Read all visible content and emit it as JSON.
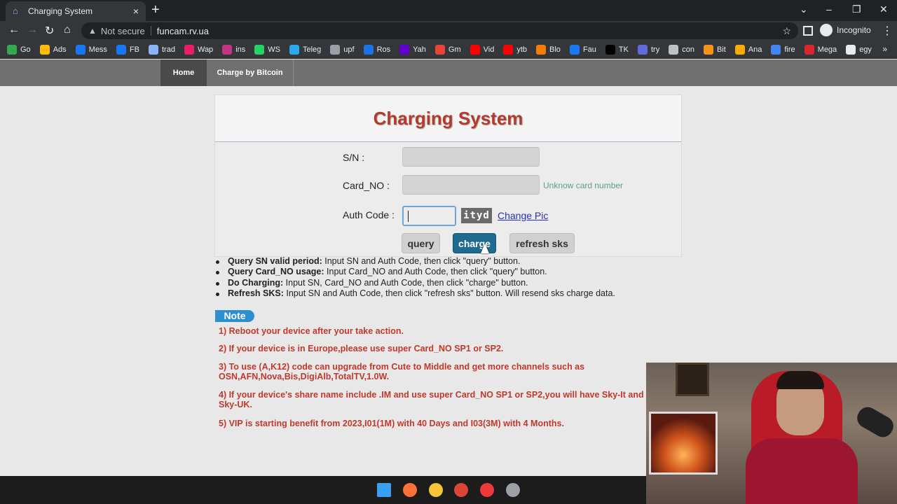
{
  "browser": {
    "tab_title": "Charging System",
    "tab_close": "×",
    "new_tab": "+",
    "security_label": "Not secure",
    "url": "funcam.rv.ua",
    "profile_label": "Incognito",
    "window_controls": [
      "⌄",
      "–",
      "❐",
      "✕"
    ]
  },
  "bookmarks": [
    {
      "label": "Go",
      "color": "#34a853"
    },
    {
      "label": "Ads",
      "color": "#fbbc04"
    },
    {
      "label": "Mess",
      "color": "#1877f2"
    },
    {
      "label": "FB",
      "color": "#1877f2"
    },
    {
      "label": "trad",
      "color": "#8ab4f8"
    },
    {
      "label": "Wap",
      "color": "#e91e63"
    },
    {
      "label": "ins",
      "color": "#c13584"
    },
    {
      "label": "WS",
      "color": "#25d366"
    },
    {
      "label": "Teleg",
      "color": "#29a9eb"
    },
    {
      "label": "upf",
      "color": "#9aa0a6"
    },
    {
      "label": "Ros",
      "color": "#1a73e8"
    },
    {
      "label": "Yah",
      "color": "#6001d2"
    },
    {
      "label": "Gm",
      "color": "#ea4335"
    },
    {
      "label": "Vid",
      "color": "#ff0000"
    },
    {
      "label": "ytb",
      "color": "#ff0000"
    },
    {
      "label": "Blo",
      "color": "#f57d00"
    },
    {
      "label": "Fau",
      "color": "#1877f2"
    },
    {
      "label": "TK",
      "color": "#010101"
    },
    {
      "label": "try",
      "color": "#5f6bd8"
    },
    {
      "label": "con",
      "color": "#bdc1c6"
    },
    {
      "label": "Bit",
      "color": "#f7931a"
    },
    {
      "label": "Ana",
      "color": "#f9ab00"
    },
    {
      "label": "fire",
      "color": "#4285f4"
    },
    {
      "label": "Mega",
      "color": "#d9272e"
    },
    {
      "label": "egy",
      "color": "#e8eaed"
    }
  ],
  "bookmarks_more": "»",
  "site_nav": {
    "home": "Home",
    "bitcoin": "Charge by Bitcoin"
  },
  "form": {
    "title": "Charging System",
    "sn_label": "S/N :",
    "card_label": "Card_NO :",
    "card_hint": "Unknow card number",
    "auth_label": "Auth Code :",
    "captcha_text": "ityd",
    "change_pic": "Change Pic",
    "query_btn": "query",
    "charge_btn": "charge",
    "refresh_btn": "refresh sks"
  },
  "instructions": [
    {
      "bold": "Query SN valid period:",
      "text": " Input SN and Auth Code, then click \"query\" button."
    },
    {
      "bold": "Query Card_NO usage:",
      "text": " Input Card_NO and Auth Code, then click \"query\" button."
    },
    {
      "bold": "Do Charging:",
      "text": " Input SN, Card_NO and Auth Code, then click \"charge\" button."
    },
    {
      "bold": "Refresh SKS:",
      "text": " Input SN and Auth Code, then click \"refresh sks\" button. Will resend sks charge data."
    }
  ],
  "note": {
    "badge": "Note",
    "items": [
      "1) Reboot your device after your take action.",
      "2) If your device is in Europe,please use super Card_NO SP1 or SP2.",
      "3) To use (A,K12) code can upgrade from Cute to Middle and get more channels such as OSN,AFN,Nova,Bis,DigiAlb,TotalTV,1.0W.",
      "4) If your device's share name include .IM and use super Card_NO SP1 or SP2,you will have Sky-It and Sky-UK.",
      "5) VIP is starting benefit from 2023,I01(1M) with 40 Days and I03(3M) with 4 Months."
    ]
  },
  "taskbar_icons": [
    {
      "name": "windows-start-icon",
      "color": "#3aa0f3"
    },
    {
      "name": "firefox-icon",
      "color": "#ff7139"
    },
    {
      "name": "file-explorer-icon",
      "color": "#f8c43a"
    },
    {
      "name": "chrome-icon",
      "color": "#db4437"
    },
    {
      "name": "vivaldi-icon",
      "color": "#ef3939"
    },
    {
      "name": "obs-icon",
      "color": "#9aa0a6"
    }
  ]
}
